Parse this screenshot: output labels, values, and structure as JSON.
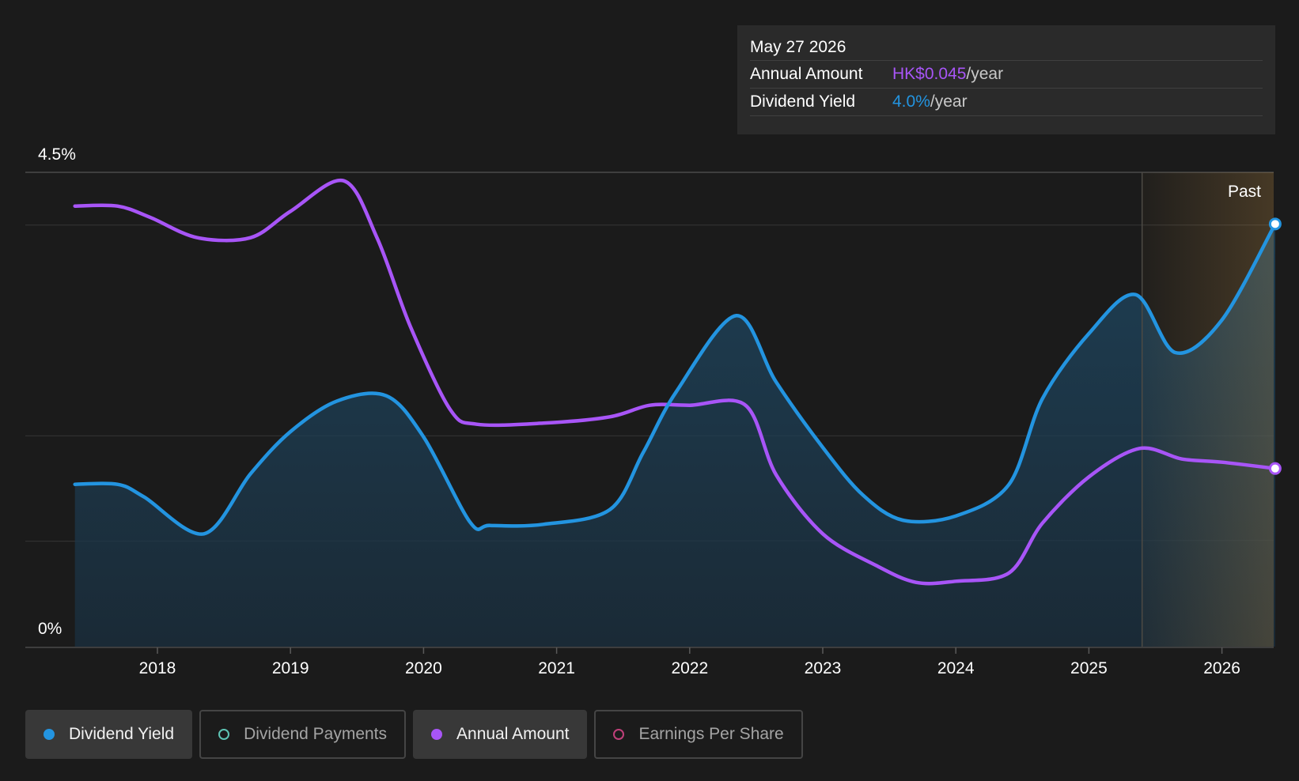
{
  "tooltip": {
    "date": "May 27 2026",
    "rows": [
      {
        "label": "Annual Amount",
        "value": "HK$0.045",
        "unit": "/year"
      },
      {
        "label": "Dividend Yield",
        "value": "4.0%",
        "unit": "/year"
      }
    ]
  },
  "legend": [
    {
      "label": "Dividend Yield",
      "color": "#2394e0",
      "active": true
    },
    {
      "label": "Dividend Payments",
      "color": "#5ec4b4",
      "active": false
    },
    {
      "label": "Annual Amount",
      "color": "#a855f7",
      "active": true
    },
    {
      "label": "Earnings Per Share",
      "color": "#c0407a",
      "active": false
    }
  ],
  "chart_data": {
    "type": "line",
    "title": "",
    "xlabel": "",
    "ylabel": "",
    "x_ticks": [
      "2018",
      "2019",
      "2020",
      "2021",
      "2022",
      "2023",
      "2024",
      "2025",
      "2026"
    ],
    "xlim": [
      2017.38,
      2026.4
    ],
    "ylim": [
      0,
      4.5
    ],
    "y_tick_labels": [
      "0%",
      "4.5%"
    ],
    "grid": true,
    "past_label": "Past",
    "past_start": 2025.4,
    "colors": {
      "yield": "#2394e0",
      "amount": "#a855f7",
      "past": "#e0a34a"
    },
    "series": [
      {
        "name": "Dividend Yield",
        "unit": "%",
        "points": [
          [
            2017.38,
            1.54
          ],
          [
            2017.7,
            1.54
          ],
          [
            2017.9,
            1.42
          ],
          [
            2018.35,
            1.07
          ],
          [
            2018.7,
            1.64
          ],
          [
            2019.0,
            2.04
          ],
          [
            2019.35,
            2.33
          ],
          [
            2019.72,
            2.38
          ],
          [
            2020.0,
            1.99
          ],
          [
            2020.35,
            1.18
          ],
          [
            2020.5,
            1.15
          ],
          [
            2020.9,
            1.16
          ],
          [
            2021.4,
            1.3
          ],
          [
            2021.65,
            1.84
          ],
          [
            2021.9,
            2.42
          ],
          [
            2022.35,
            3.14
          ],
          [
            2022.65,
            2.51
          ],
          [
            2023.0,
            1.89
          ],
          [
            2023.3,
            1.44
          ],
          [
            2023.6,
            1.2
          ],
          [
            2024.0,
            1.24
          ],
          [
            2024.4,
            1.54
          ],
          [
            2024.65,
            2.35
          ],
          [
            2025.0,
            2.97
          ],
          [
            2025.35,
            3.34
          ],
          [
            2025.65,
            2.79
          ],
          [
            2026.0,
            3.1
          ],
          [
            2026.4,
            4.01
          ]
        ]
      },
      {
        "name": "Annual Amount",
        "unit": "HK$",
        "points": [
          [
            2017.38,
            4.18
          ],
          [
            2017.7,
            4.18
          ],
          [
            2017.95,
            4.07
          ],
          [
            2018.3,
            3.88
          ],
          [
            2018.7,
            3.88
          ],
          [
            2019.0,
            4.13
          ],
          [
            2019.4,
            4.42
          ],
          [
            2019.65,
            3.88
          ],
          [
            2019.9,
            3.04
          ],
          [
            2020.2,
            2.25
          ],
          [
            2020.4,
            2.11
          ],
          [
            2020.9,
            2.12
          ],
          [
            2021.4,
            2.18
          ],
          [
            2021.7,
            2.29
          ],
          [
            2022.0,
            2.29
          ],
          [
            2022.42,
            2.29
          ],
          [
            2022.65,
            1.63
          ],
          [
            2023.0,
            1.07
          ],
          [
            2023.4,
            0.77
          ],
          [
            2023.7,
            0.61
          ],
          [
            2024.0,
            0.62
          ],
          [
            2024.4,
            0.7
          ],
          [
            2024.65,
            1.17
          ],
          [
            2025.0,
            1.61
          ],
          [
            2025.38,
            1.88
          ],
          [
            2025.7,
            1.78
          ],
          [
            2026.0,
            1.75
          ],
          [
            2026.4,
            1.69
          ]
        ]
      }
    ]
  }
}
